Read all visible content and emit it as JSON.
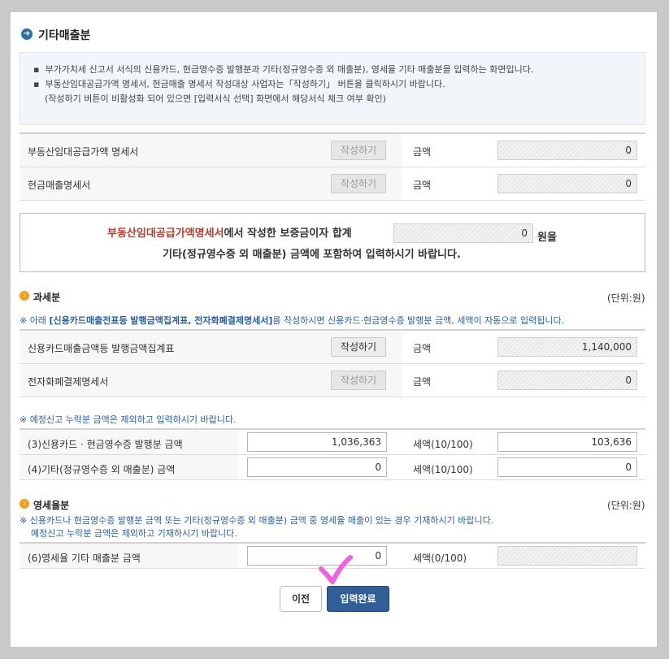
{
  "page": {
    "title": "기타매출분",
    "title_icon": "arrow-right-circle-icon"
  },
  "info": {
    "line1": "부가가치세 신고서 서식의 신용카드, 현금영수증 발행분과 기타(정규영수증 외 매출분), 영세율 기타 매출분을 입력하는 화면입니다.",
    "line2": "부동산임대공급가액 명세서, 현금매출 명세서 작성대상 사업자는「작성하기」 버튼을 클릭하시기 바랍니다.",
    "line3": "(작성하기 버튼이 비활성화 되어 있으면 [입력서식 선택] 화면에서 해당서식 체크 여부 확인)"
  },
  "top_table": {
    "rows": [
      {
        "label": "부동산임대공급가액 명세서",
        "button": "작성하기",
        "amount_label": "금액",
        "amount": "0"
      },
      {
        "label": "현금매출명세서",
        "button": "작성하기",
        "amount_label": "금액",
        "amount": "0"
      }
    ]
  },
  "notice": {
    "part1_red": "부동산임대공급가액명세서",
    "part1_rest": "에서 작성한 보증금이자 합계",
    "value": "0",
    "part2": "원을",
    "line2": "기타(정규영수증 외 매출분) 금액에 포함하여 입력하시기 바랍니다."
  },
  "taxable": {
    "title": "과세분",
    "unit": "(단위:원)",
    "note_prefix": "※ 아래 ",
    "note_bold": "[신용카드매출전표등 발행금액집계표, 전자화폐결제명세서]",
    "note_suffix": "를 작성하시면 신용카드·현금영수증 발행분 금액, 세액이 자동으로 입력됩니다.",
    "rows": [
      {
        "label": "신용카드매출금액등 발행금액집계표",
        "button": "작성하기",
        "amount_label": "금액",
        "amount": "1,140,000"
      },
      {
        "label": "전자화폐결제명세서",
        "button": "작성하기",
        "amount_label": "금액",
        "amount": "0"
      }
    ],
    "note2": "※ 예정신고 누락분 금액은 제외하고 입력하시기 바랍니다.",
    "input_rows": [
      {
        "label": "(3)신용카드 · 현금영수증 발행분 금액",
        "amount": "1,036,363",
        "tax_label": "세액(10/100)",
        "tax": "103,636"
      },
      {
        "label": "(4)기타(정규영수증 외 매출분) 금액",
        "amount": "0",
        "tax_label": "세액(10/100)",
        "tax": "0"
      }
    ]
  },
  "zero_rated": {
    "title": "영세율분",
    "unit": "(단위:원)",
    "note1": "※ 신용카드나 현금영수증 발행분 금액 또는 기타(정규영수증 외 매출분) 금액 중 영세율 매출이 있는 경우 기재하시기 바랍니다.",
    "note2": "예정신고 누락분 금액은 제외하고 기재하시기 바랍니다.",
    "row": {
      "label": "(6)영세율 기타 매출분 금액",
      "amount": "0",
      "tax_label": "세액(0/100)",
      "tax": ""
    }
  },
  "buttons": {
    "prev": "이전",
    "complete": "입력완료"
  },
  "colors": {
    "accent": "#2e6fa8",
    "primary_button": "#2f5f96",
    "warning_red": "#c0392b",
    "section_icon": "#f0a020",
    "annotation": "#f060e0"
  }
}
